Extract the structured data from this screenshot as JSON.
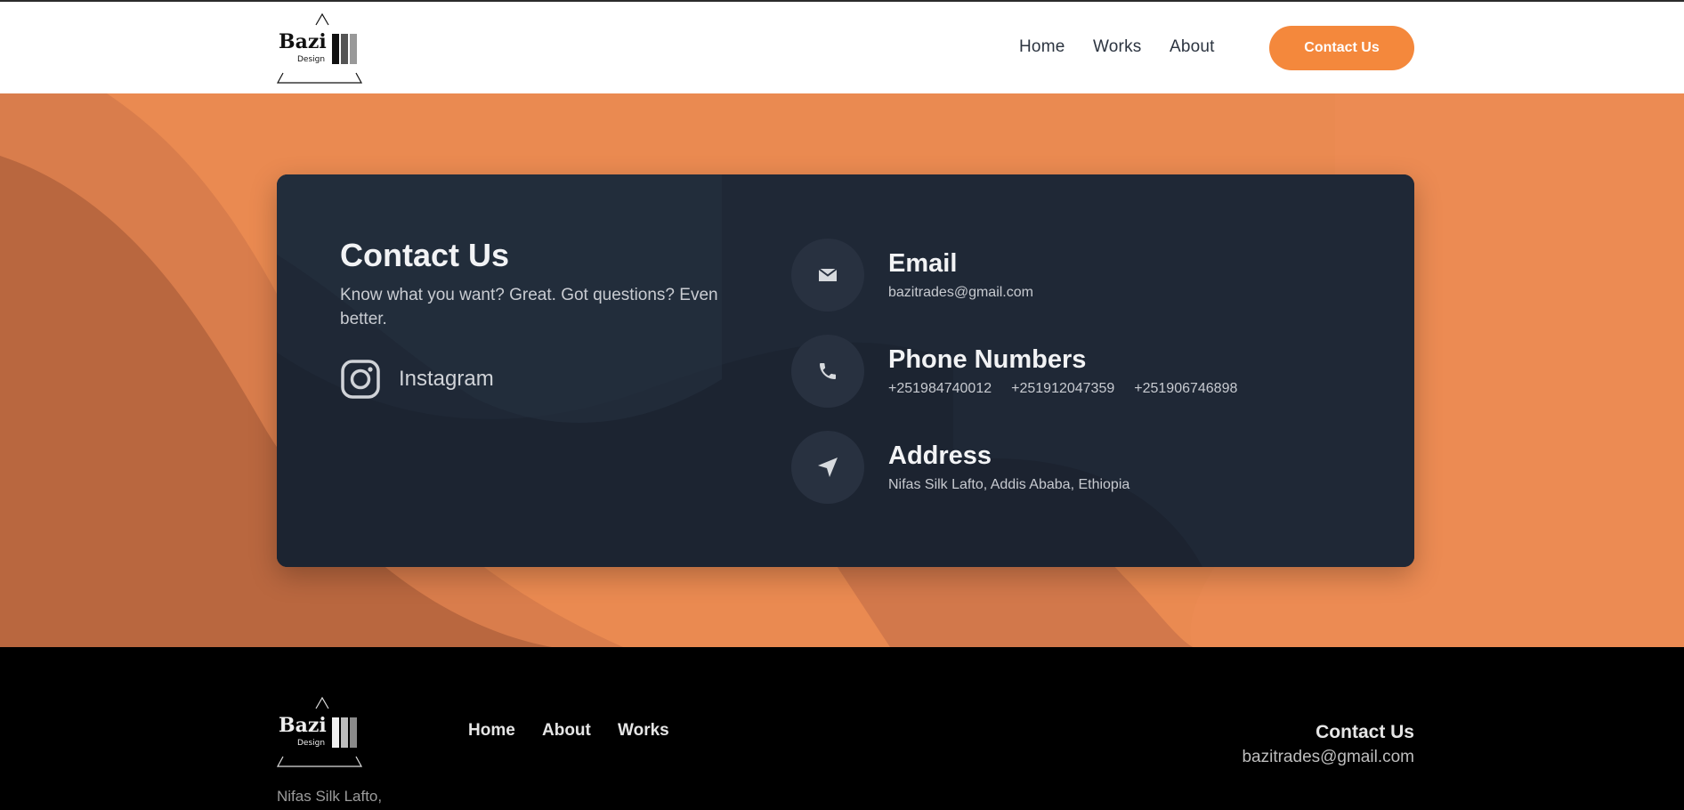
{
  "brand": {
    "logo_main": "Bazi",
    "logo_sub": "Design"
  },
  "nav": {
    "home": "Home",
    "works": "Works",
    "about": "About",
    "cta": "Contact Us"
  },
  "contact": {
    "title": "Contact Us",
    "subtitle": "Know what you want? Great. Got questions? Even better.",
    "instagram_label": "Instagram",
    "email_heading": "Email",
    "email_value": "bazitrades@gmail.com",
    "phone_heading": "Phone Numbers",
    "phones": [
      "+251984740012",
      "+251912047359",
      "+251906746898"
    ],
    "address_heading": "Address",
    "address_value": "Nifas Silk Lafto, Addis Ababa, Ethiopia"
  },
  "footer": {
    "nav": {
      "home": "Home",
      "about": "About",
      "works": "Works"
    },
    "contact_heading": "Contact Us",
    "email": "bazitrades@gmail.com",
    "address_partial": "Nifas Silk Lafto,"
  },
  "icons": {
    "instagram": "instagram-icon",
    "email": "mail-icon",
    "phone": "phone-icon",
    "address": "location-arrow-icon"
  },
  "colors": {
    "accent": "#f4883c",
    "hero_bg": "#e9884f",
    "card_bg": "#1f2836",
    "footer_bg": "#000000"
  }
}
